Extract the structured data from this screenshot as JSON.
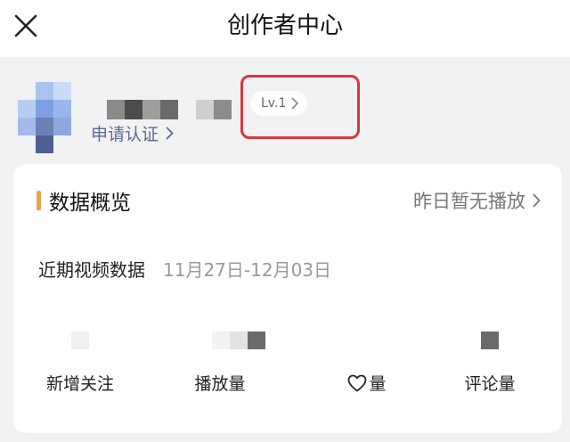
{
  "header": {
    "title": "创作者中心",
    "close_icon": "close-icon"
  },
  "profile": {
    "level_badge": "Lv.1",
    "apply_link": "申请认证"
  },
  "overview": {
    "title": "数据概览",
    "no_play_link": "昨日暂无播放",
    "recent_label": "近期视频数据",
    "date_range": "11月27日-12月03日",
    "stats": [
      {
        "label": "新增关注"
      },
      {
        "label": "播放量"
      },
      {
        "label": "量",
        "icon": "heart-icon"
      },
      {
        "label": "评论量"
      }
    ]
  },
  "colors": {
    "accent_bar": "#f0a04b",
    "highlight_box": "#d9363e",
    "link": "#5a6b92"
  }
}
